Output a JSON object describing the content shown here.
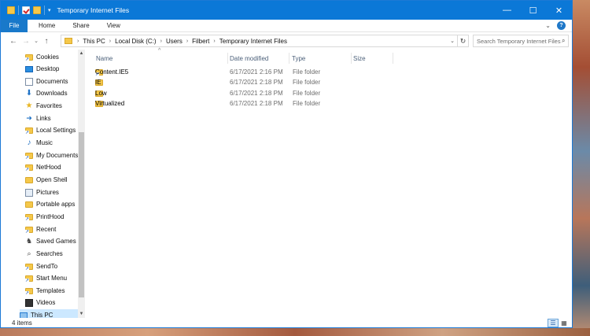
{
  "window": {
    "title": "Temporary Internet Files"
  },
  "ribbon": {
    "tabs": [
      "File",
      "Home",
      "Share",
      "View"
    ]
  },
  "address": {
    "crumbs": [
      "This PC",
      "Local Disk (C:)",
      "Users",
      "Filbert",
      "Temporary Internet Files"
    ]
  },
  "search": {
    "placeholder": "Search Temporary Internet Files"
  },
  "sidebar": {
    "items": [
      {
        "label": "Cookies",
        "icon": "shortcut-folder-icon"
      },
      {
        "label": "Desktop",
        "icon": "desktop-icon"
      },
      {
        "label": "Documents",
        "icon": "documents-icon"
      },
      {
        "label": "Downloads",
        "icon": "downloads-icon"
      },
      {
        "label": "Favorites",
        "icon": "star-icon"
      },
      {
        "label": "Links",
        "icon": "link-icon"
      },
      {
        "label": "Local Settings",
        "icon": "shortcut-folder-icon"
      },
      {
        "label": "Music",
        "icon": "music-icon"
      },
      {
        "label": "My Documents",
        "icon": "shortcut-folder-icon"
      },
      {
        "label": "NetHood",
        "icon": "shortcut-folder-icon"
      },
      {
        "label": "Open Shell",
        "icon": "folder-icon"
      },
      {
        "label": "Pictures",
        "icon": "pictures-icon"
      },
      {
        "label": "Portable apps",
        "icon": "folder-icon"
      },
      {
        "label": "PrintHood",
        "icon": "shortcut-folder-icon"
      },
      {
        "label": "Recent",
        "icon": "shortcut-folder-icon"
      },
      {
        "label": "Saved Games",
        "icon": "games-icon"
      },
      {
        "label": "Searches",
        "icon": "search-icon"
      },
      {
        "label": "SendTo",
        "icon": "shortcut-folder-icon"
      },
      {
        "label": "Start Menu",
        "icon": "shortcut-folder-icon"
      },
      {
        "label": "Templates",
        "icon": "shortcut-folder-icon"
      },
      {
        "label": "Videos",
        "icon": "videos-icon"
      },
      {
        "label": "This PC",
        "icon": "this-pc-icon"
      }
    ]
  },
  "columns": {
    "name": "Name",
    "date": "Date modified",
    "type": "Type",
    "size": "Size"
  },
  "files": [
    {
      "name": "Content.IE5",
      "date": "6/17/2021 2:16 PM",
      "type": "File folder",
      "icon": "shortcut-folder-icon"
    },
    {
      "name": "IE",
      "date": "6/17/2021 2:18 PM",
      "type": "File folder",
      "icon": "folder-icon"
    },
    {
      "name": "Low",
      "date": "6/17/2021 2:18 PM",
      "type": "File folder",
      "icon": "folder-icon"
    },
    {
      "name": "Virtualized",
      "date": "6/17/2021 2:18 PM",
      "type": "File folder",
      "icon": "folder-icon"
    }
  ],
  "status": {
    "count": "4 items"
  },
  "colors": {
    "titlebar": "#0b78d7",
    "file_tab": "#1979ca",
    "selection": "#cce8ff",
    "folder": "#f5c84a"
  }
}
